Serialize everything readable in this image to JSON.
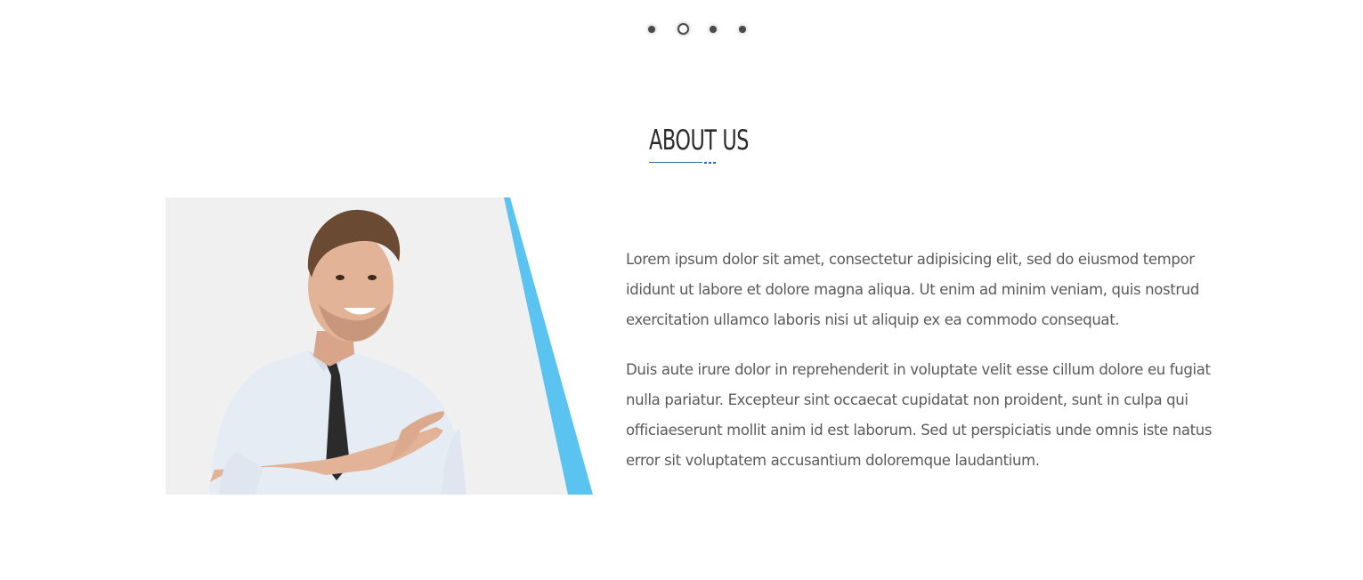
{
  "carousel": {
    "dots": [
      {
        "label": "slide 1",
        "active": false
      },
      {
        "label": "slide 2",
        "active": true
      },
      {
        "label": "slide 3",
        "active": false
      },
      {
        "label": "slide 4",
        "active": false
      }
    ]
  },
  "about": {
    "title": "ABOUT US",
    "paragraphs": [
      "Lorem ipsum dolor sit amet, consectetur adipisicing elit, sed do eiusmod tempor ididunt ut labore et dolore magna aliqua. Ut enim ad minim veniam, quis nostrud exercitation ullamco laboris nisi ut aliquip ex ea commodo consequat.",
      "Duis aute irure dolor in reprehenderit in voluptate velit esse cillum dolore eu fugiat nulla pariatur. Excepteur sint occaecat cupidatat non proident, sunt in culpa qui officiaeserunt mollit anim id est laborum. Sed ut perspiciatis unde omnis iste natus error sit voluptatem accusantium doloremque laudantium."
    ]
  },
  "colors": {
    "accent_stripe": "#5bc3ef",
    "image_background": "#f0f0f0",
    "title_underline": "#2a6aa8",
    "body_text": "#5a5a5a",
    "heading_text": "#2b2b2b"
  }
}
